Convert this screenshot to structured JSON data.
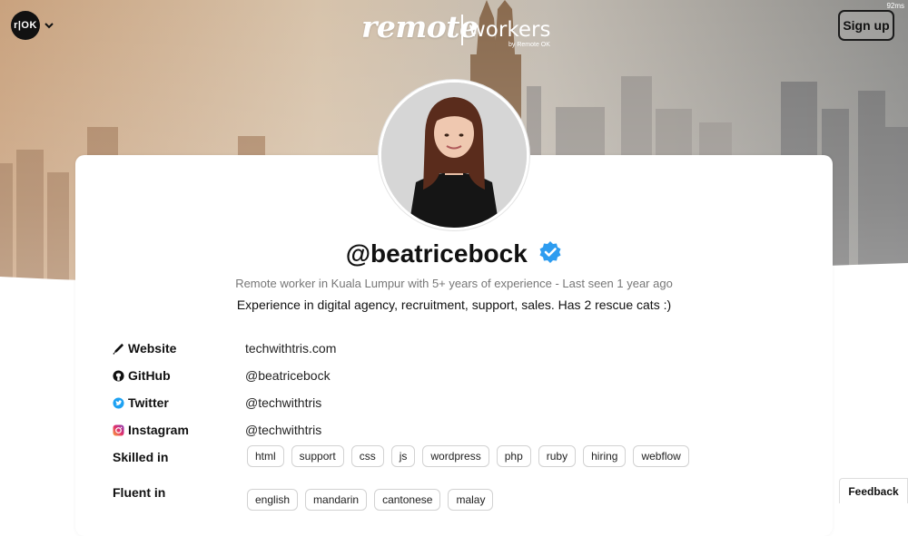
{
  "header": {
    "logo_text": "r|OK",
    "brand_primary": "remote",
    "brand_secondary": "workers",
    "brand_byline": "by Remote OK",
    "timing": "92ms",
    "signup_label": "Sign up"
  },
  "profile": {
    "handle": "@beatricebock",
    "verified_icon": "verified-badge-icon",
    "subtitle": "Remote worker in Kuala Lumpur with 5+ years of experience - Last seen 1 year ago",
    "bio": "Experience in digital agency, recruitment, support, sales. Has 2 rescue cats :)"
  },
  "links": [
    {
      "label": "Website",
      "icon": "pen-icon",
      "value": "techwithtris.com"
    },
    {
      "label": "GitHub",
      "icon": "github-icon",
      "value": "@beatricebock"
    },
    {
      "label": "Twitter",
      "icon": "twitter-icon",
      "value": "@techwithtris"
    },
    {
      "label": "Instagram",
      "icon": "instagram-icon",
      "value": "@techwithtris"
    }
  ],
  "skills": {
    "label": "Skilled in",
    "items": [
      "html",
      "support",
      "css",
      "js",
      "wordpress",
      "php",
      "ruby",
      "hiring",
      "webflow"
    ]
  },
  "languages": {
    "label": "Fluent in",
    "items": [
      "english",
      "mandarin",
      "cantonese",
      "malay"
    ]
  },
  "feedback_label": "Feedback",
  "colors": {
    "verified": "#2d9cf0",
    "twitter": "#1da1f2",
    "text": "#111111",
    "muted": "#777777"
  }
}
